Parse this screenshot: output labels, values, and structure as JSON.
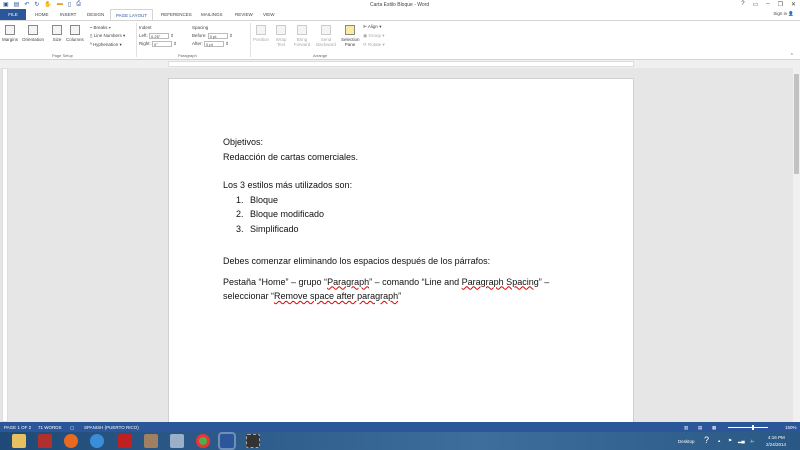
{
  "window": {
    "title": "Carta Estilo Bloque - Word",
    "help": "?",
    "minimize": "–",
    "restore": "❐",
    "close": "✕",
    "sign_in": "Sign in"
  },
  "qat": [
    "save",
    "undo",
    "redo",
    "touch",
    "folder",
    "new",
    "print-preview"
  ],
  "tabs": [
    "FILE",
    "HOME",
    "INSERT",
    "DESIGN",
    "PAGE LAYOUT",
    "REFERENCES",
    "MAILINGS",
    "REVIEW",
    "VIEW"
  ],
  "ribbon": {
    "page_setup": {
      "margins": "Margins",
      "orientation": "Orientation",
      "size": "Size",
      "columns": "Columns",
      "breaks": "Breaks",
      "line_numbers": "Line Numbers",
      "hyphenation": "Hyphenation",
      "group": "Page Setup"
    },
    "paragraph": {
      "indent": "Indent",
      "left_label": "Left:",
      "left_value": "0.25\"",
      "right_label": "Right:",
      "right_value": "0\"",
      "spacing": "Spacing",
      "before_label": "Before:",
      "before_value": "0 pt",
      "after_label": "After:",
      "after_value": "0 pt",
      "group": "Paragraph"
    },
    "arrange": {
      "position": "Position",
      "wrap_text": "Wrap Text",
      "bring_forward": "Bring Forward",
      "send_backward": "Send Backward",
      "selection_pane": "Selection Pane",
      "align": "Align",
      "group_btn": "Group",
      "rotate": "Rotate",
      "group": "Arrange"
    }
  },
  "document": {
    "line1": "Objetivos:",
    "line2": "Redacción de cartas comerciales.",
    "line3": "Los 3 estilos más utilizados son:",
    "list": [
      {
        "n": "1.",
        "t": "Bloque"
      },
      {
        "n": "2.",
        "t": "Bloque modificado"
      },
      {
        "n": "3.",
        "t": "Simplificado"
      }
    ],
    "line4": "Debes comenzar eliminando los espacios después de los párrafos:",
    "p_a": "Pestaña “Home” – grupo “",
    "p_b": "Paragraph",
    "p_c": "” – comando “Line and ",
    "p_d": "Paragraph Spacing",
    "p_e": "” – seleccionar “",
    "p_f": "Remove space after paragraph",
    "p_g": "”"
  },
  "status": {
    "page": "PAGE 1 OF 2",
    "words": "71 WORDS",
    "language": "SPANISH (PUERTO RICO)",
    "zoom": "150%"
  },
  "taskbar": {
    "desktop": "Desktop",
    "time": "4:16 PM",
    "date": "2/24/2014"
  },
  "colors": {
    "accent": "#2b579a"
  }
}
